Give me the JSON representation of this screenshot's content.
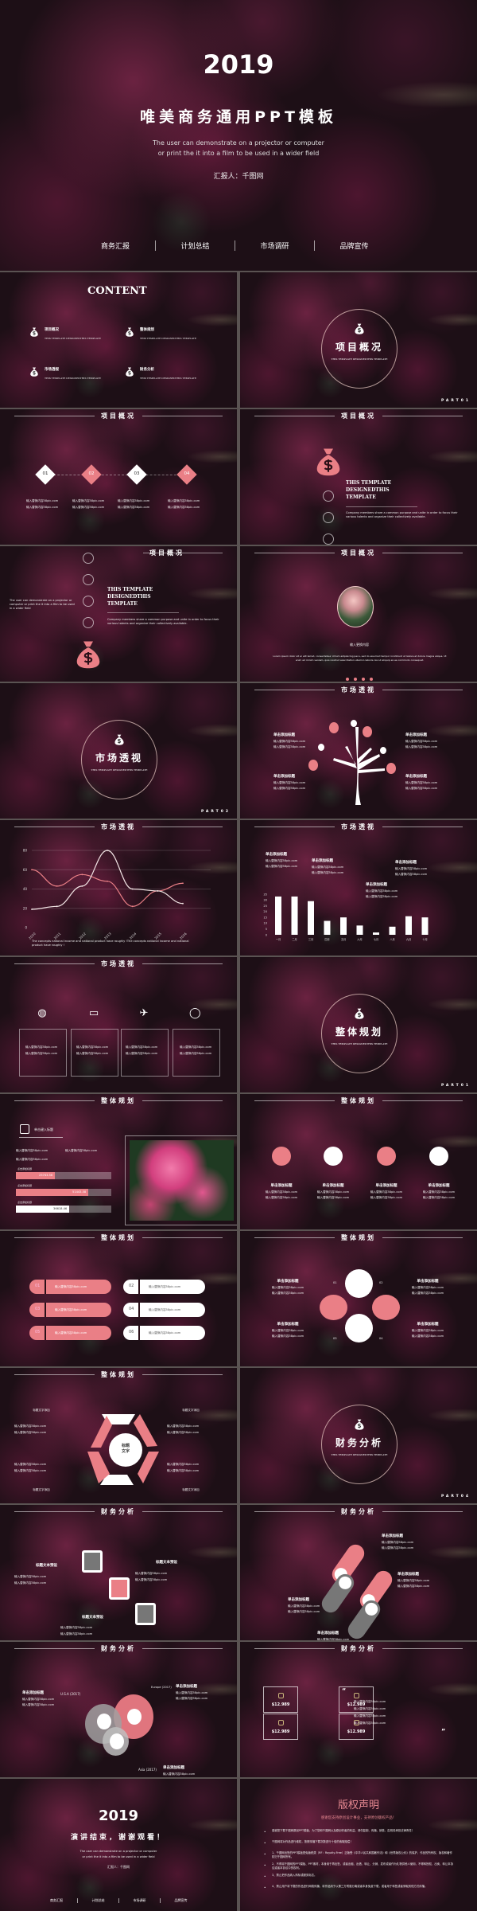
{
  "placeholder": "输入替换内容58pic.com",
  "item_title": "单击添加标题",
  "colors": {
    "accent": "#ea7f86",
    "grey": "#777777",
    "background": "#1d0f16"
  },
  "cover": {
    "year": "2019",
    "title": "唯美商务通用PPT模板",
    "subtitle": [
      "The user can demonstrate on a projector or computer",
      "or print the it into a film to be used in a wider field"
    ],
    "reporter": "汇报人：千图网",
    "nav": [
      "商务汇报",
      "计划总结",
      "市场调研",
      "品牌宣传"
    ]
  },
  "content": {
    "title": "CONTENT",
    "items": [
      {
        "label": "项目概况",
        "sub": "THIS TEMPLATE DESIGNEDTHIS TEMPLATE",
        "icon": "money-bag-icon"
      },
      {
        "label": "整体规划",
        "sub": "THIS TEMPLATE DESIGNEDTHIS TEMPLATE",
        "icon": "money-bag-icon"
      },
      {
        "label": "市场透视",
        "sub": "THIS TEMPLATE DESIGNEDTHIS TEMPLATE",
        "icon": "money-bag-icon"
      },
      {
        "label": "财务分析",
        "sub": "THIS TEMPLATE DESIGNEDTHIS TEMPLATE",
        "icon": "money-bag-icon"
      }
    ]
  },
  "sections": [
    {
      "title": "项目概况",
      "sub": "THIS TEMPLATE DESIGNEDTHIS TEMPLATE",
      "part": "PART01"
    },
    {
      "title": "市场透视",
      "sub": "THIS TEMPLATE DESIGNEDTHIS TEMPLATE",
      "part": "PART02"
    },
    {
      "title": "整体规划",
      "sub": "THIS TEMPLATE DESIGNEDTHIS TEMPLATE",
      "part": "PART01"
    },
    {
      "title": "财务分析",
      "sub": "THIS TEMPLATE DESIGNEDTHIS TEMPLATE",
      "part": "PART04"
    }
  ],
  "h": {
    "xm": "项目概况",
    "sc": "市场透视",
    "zt": "整体规划",
    "cw": "财务分析"
  },
  "steps": [
    "01",
    "02",
    "03",
    "04"
  ],
  "template_title": "THIS TEMPLATE DESIGNEDTHIS TEMPLATE",
  "company_desc": "Company members share a common purpose and unite in order to focus their various talents and organize their collectively available.",
  "side_text": "The user can demonstrate on a projector or computer or print the it into a film to be used in a wider field",
  "photo_slide": {
    "caption": "输入更换内容",
    "lorem": "Lorem ipsum dolor sit er elit lamet, consectetaur cillium adipisicing pecu, sed do eiusmod tempor incididunt ut labore et dolore magna aliqua. Ut enim ad minim veniam, quis nostrud exercitation ullamco laboris nisi ut aliquip ex ea commodo consequat."
  },
  "line_note": "The concepts national income and national product have roughly !The concepts national income and national product have roughly !",
  "chart_data": [
    {
      "type": "line",
      "x": [
        "2010",
        "2011",
        "2012",
        "2013",
        "2014",
        "2015",
        "2016"
      ],
      "ylim": [
        0,
        80
      ],
      "yticks": [
        0,
        20,
        40,
        60,
        80
      ],
      "grid": true,
      "series": [
        {
          "color": "#ea7f86",
          "values": [
            60,
            43,
            55,
            48,
            22,
            38,
            46
          ]
        },
        {
          "color": "#f3e6e6",
          "values": [
            19,
            22,
            43,
            80,
            40,
            38,
            25
          ]
        }
      ]
    },
    {
      "type": "bar",
      "categories": [
        "一月",
        "二月",
        "三月",
        "四月",
        "五月",
        "六月",
        "七月",
        "八月",
        "九月",
        "十月"
      ],
      "values": [
        33,
        33,
        29,
        12,
        15,
        8,
        2,
        7,
        16,
        15
      ],
      "ylim": [
        0,
        35
      ],
      "yticks": [
        0,
        5,
        10,
        15,
        20,
        25,
        30,
        35
      ],
      "color": "#ffffff"
    }
  ],
  "progress": {
    "heading": "单击键入标题",
    "bars": [
      {
        "label": "点击添加标题",
        "value": "25743.56",
        "fraction": 0.41,
        "color": "#ea7f86"
      },
      {
        "label": "点击添加标题",
        "value": "51443.58",
        "fraction": 0.76,
        "color": "#ea7f86"
      },
      {
        "label": "点击添加标题",
        "value": "36618.46",
        "fraction": 0.56,
        "color": "#ffffff"
      }
    ]
  },
  "pills": [
    "01",
    "02",
    "03",
    "04",
    "05",
    "06"
  ],
  "petals": [
    "01",
    "02",
    "03",
    "04"
  ],
  "hexagon": {
    "center": "标题文字",
    "label": "标题文字添加"
  },
  "squares_label": "标题文本预设",
  "venn_legend": [
    "U.S.A (2017)",
    "Europe (2017)",
    "Asia (2017)"
  ],
  "stats": [
    "$12.989",
    "$12.989",
    "$12.989",
    "$12.989"
  ],
  "end": {
    "year": "2019",
    "title": "演讲结束，谢谢观看！",
    "subtitle": [
      "The user can demonstrate on a projector or computer",
      "or print the it into a film to be used in a wider field"
    ],
    "reporter": "汇报人：千图网",
    "nav": [
      "商务汇报",
      "计划总结",
      "市场调研",
      "品牌宣传"
    ]
  },
  "copyright": {
    "title": "版权声明",
    "subtitle": "感谢您支持原创设计事业，支持原创版权产品！",
    "items": [
      "感谢您下载千图网原创PPT模板，为了您和千图网以及原创作者的利益，请勿复制、传播、销售，否则将承担法律责任！",
      "千图网将对作品进行维权，按照传播下载次数进行十倍的索取赔偿！",
      "1、千图网出售的PPT模板是免版税类（RF：Royalty-Free）正版受《中华人民共和国著作法》和《世界版权公约》的保护，作品的所有权、版权和著作权归千图网所有。",
      "2、不得将千图网的PPT模板、PPT素材，本身用于再出售，或者出租、出借、转让、分销、发布或者作为礼物供他人使用，不得转授权、出卖、转让本协议或者本协议中的权利。",
      "3、禁止把作品纳入商标或服务标志。",
      "4、禁止用户将下载的作品进行网络传播，将作品用于以第三方附属分离或者本身免费下载，或者用于转售或者采取其他方式传播。"
    ]
  }
}
